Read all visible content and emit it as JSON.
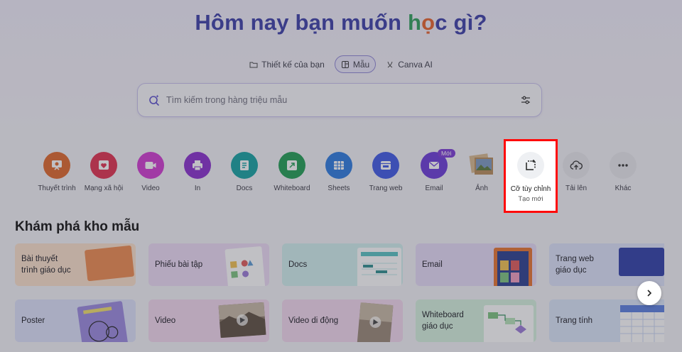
{
  "hero": {
    "title_prefix": "Hôm nay bạn muốn ",
    "title_h": "h",
    "title_o": "ọ",
    "title_c": "c",
    "title_suffix": " gì?"
  },
  "mode_tabs": [
    {
      "label": "Thiết kế của bạn",
      "icon": "folder-icon",
      "active": false
    },
    {
      "label": "Mẫu",
      "icon": "template-icon",
      "active": true
    },
    {
      "label": "Canva AI",
      "icon": "sparkle-icon",
      "active": false
    }
  ],
  "search": {
    "placeholder": "Tìm kiếm trong hàng triệu mẫu"
  },
  "categories": [
    {
      "label": "Thuyết trình",
      "icon": "presentation-icon",
      "color": "#e0682a"
    },
    {
      "label": "Mạng xã hội",
      "icon": "heart-icon",
      "color": "#e2304f"
    },
    {
      "label": "Video",
      "icon": "video-icon",
      "color": "#d23ad2"
    },
    {
      "label": "In",
      "icon": "printer-icon",
      "color": "#8a2fce"
    },
    {
      "label": "Docs",
      "icon": "docs-icon",
      "color": "#14a3a3"
    },
    {
      "label": "Whiteboard",
      "icon": "whiteboard-icon",
      "color": "#1f9e53"
    },
    {
      "label": "Sheets",
      "icon": "sheets-icon",
      "color": "#2c7be0"
    },
    {
      "label": "Trang web",
      "icon": "website-icon",
      "color": "#3f59e6"
    },
    {
      "label": "Email",
      "icon": "email-icon",
      "color": "#6b3ad9",
      "badge": "Mới"
    },
    {
      "label": "Ảnh",
      "icon": "photo-icon",
      "color": "#c8a070"
    },
    {
      "label": "Tải lên",
      "icon": "upload-cloud-icon",
      "color": "#e9e9ee"
    },
    {
      "label": "Khác",
      "icon": "more-icon",
      "color": "#e9e9ee"
    }
  ],
  "custom_size": {
    "label": "Cỡ tùy chỉnh",
    "sub": "Tạo mới"
  },
  "section": {
    "title": "Khám phá kho mẫu"
  },
  "cards_row1": [
    {
      "label": "Bài thuyết\ntrình giáo dục",
      "bg": "#fde2cc"
    },
    {
      "label": "Phiếu bài tập",
      "bg": "#eedcf7"
    },
    {
      "label": "Docs",
      "bg": "#d2f1ef"
    },
    {
      "label": "Email",
      "bg": "#e6dcf8"
    },
    {
      "label": "Trang web\ngiáo dục",
      "bg": "#dee3fb"
    }
  ],
  "cards_row2": [
    {
      "label": "Poster",
      "bg": "#dde2fb"
    },
    {
      "label": "Video",
      "bg": "#f4d9ef"
    },
    {
      "label": "Video di động",
      "bg": "#f4d9ef"
    },
    {
      "label": "Whiteboard\ngiáo dục",
      "bg": "#d6f2df"
    },
    {
      "label": "Trang tính",
      "bg": "#dbe6fa"
    }
  ]
}
